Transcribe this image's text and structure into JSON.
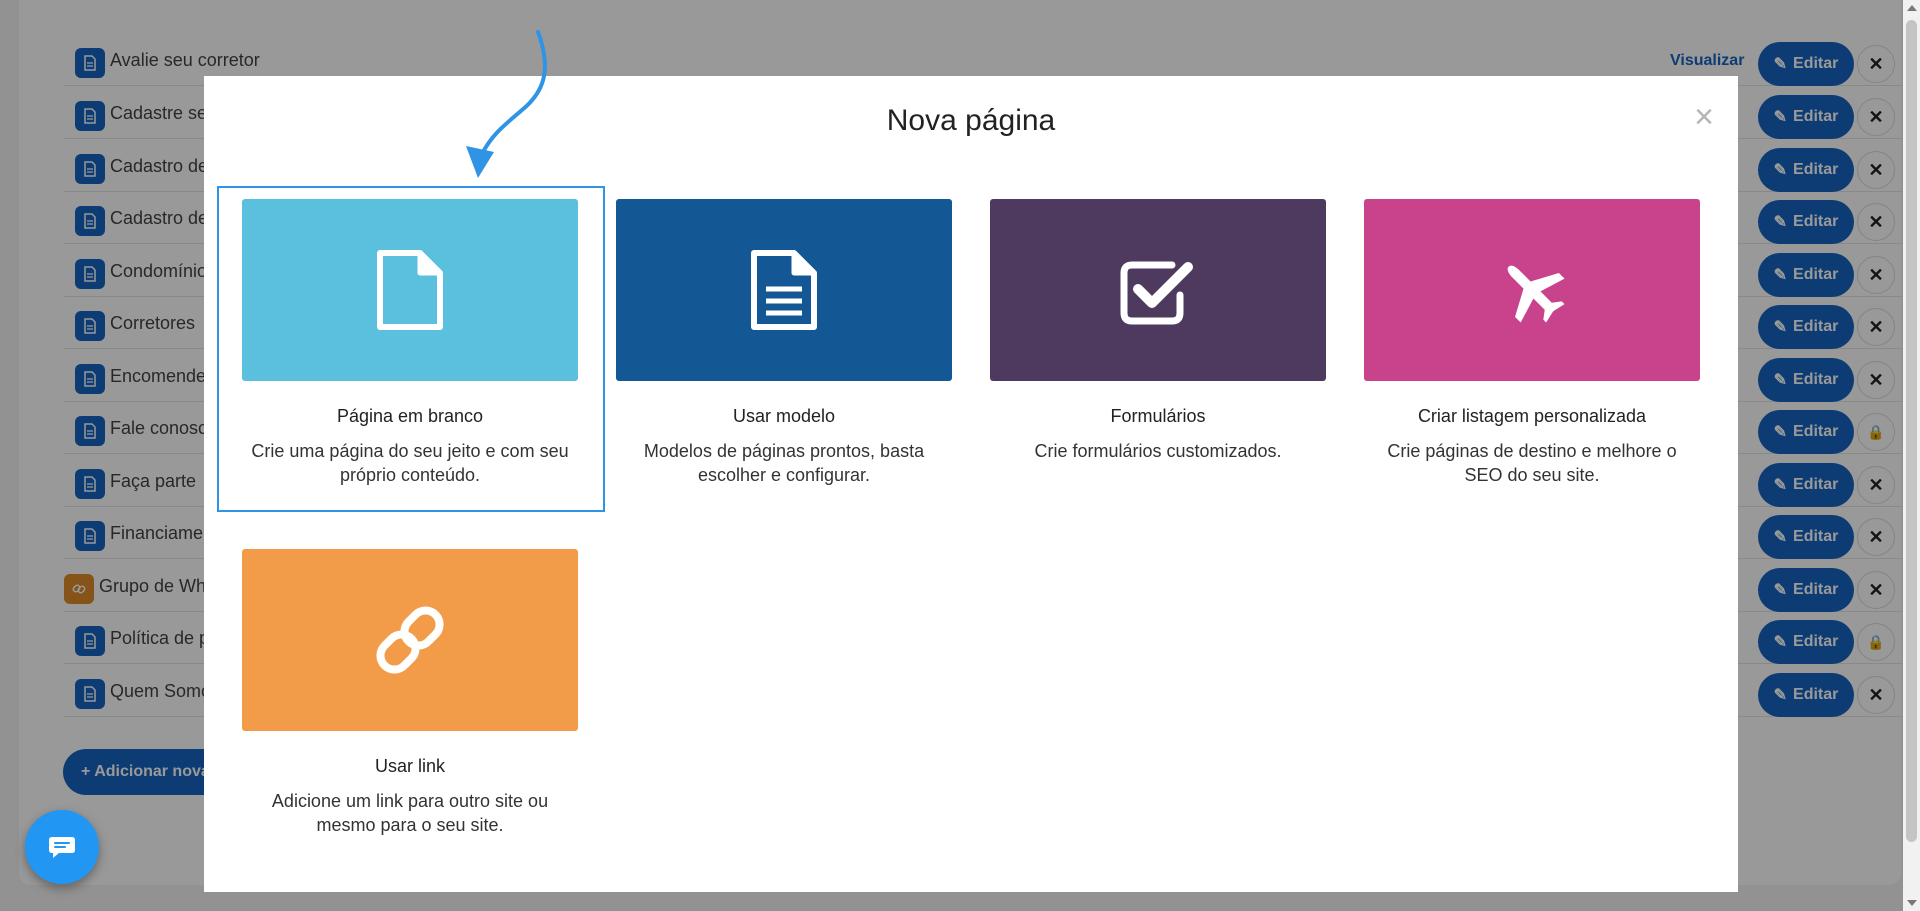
{
  "background": {
    "rows": [
      {
        "name": "Avalie seu corretor",
        "view": "Visualizar",
        "edit": "Editar",
        "action": "delete"
      },
      {
        "name": "Cadastre seu im",
        "edit": "Editar",
        "action": "delete"
      },
      {
        "name": "Cadastro de lo",
        "edit": "Editar",
        "action": "delete"
      },
      {
        "name": "Cadastro de pr",
        "edit": "Editar",
        "action": "delete"
      },
      {
        "name": "Condomínios",
        "edit": "Editar",
        "action": "delete"
      },
      {
        "name": "Corretores",
        "edit": "Editar",
        "action": "delete"
      },
      {
        "name": "Encomende se",
        "edit": "Editar",
        "action": "delete"
      },
      {
        "name": "Fale conosco",
        "edit": "Editar",
        "action": "lock"
      },
      {
        "name": "Faça parte",
        "edit": "Editar",
        "action": "delete"
      },
      {
        "name": "Financiamento",
        "edit": "Editar",
        "action": "delete"
      },
      {
        "name": "Grupo de Whats",
        "edit": "Editar",
        "action": "delete",
        "type": "link"
      },
      {
        "name": "Política de priv",
        "edit": "Editar",
        "action": "lock"
      },
      {
        "name": "Quem Somos",
        "edit": "Editar",
        "action": "delete"
      }
    ],
    "add_button": "+ Adicionar nova pá"
  },
  "modal": {
    "title": "Nova página",
    "close": "×",
    "options": [
      {
        "title": "Página em branco",
        "description": "Crie uma página do seu jeito e com seu próprio conteúdo.",
        "color": "#5bc0de",
        "icon": "blank-page-icon"
      },
      {
        "title": "Usar modelo",
        "description": "Modelos de páginas prontos, basta escolher e configurar.",
        "color": "#135895",
        "icon": "template-page-icon"
      },
      {
        "title": "Formulários",
        "description": "Crie formulários customizados.",
        "color": "#4f3a5f",
        "icon": "checkbox-icon"
      },
      {
        "title": "Criar listagem personalizada",
        "description": "Crie páginas de destino e melhore o SEO do seu site.",
        "color": "#c9428c",
        "icon": "airplane-icon"
      },
      {
        "title": "Usar link",
        "description": "Adicione um link para outro site ou mesmo para o seu site.",
        "color": "#f29c4a",
        "icon": "chain-link-icon"
      }
    ]
  }
}
